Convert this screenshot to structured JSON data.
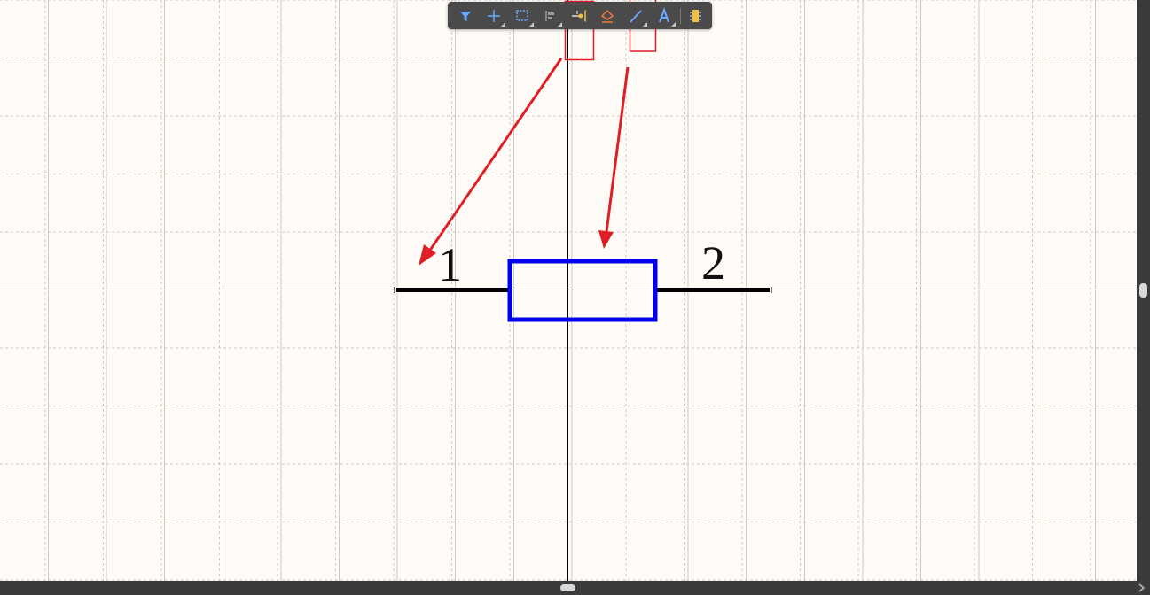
{
  "toolbar": {
    "buttons": [
      {
        "name": "filter",
        "icon": "filter-icon",
        "color": "#6aa9ff",
        "has_dropdown": false
      },
      {
        "name": "move",
        "icon": "crosshair-icon",
        "color": "#6aa9ff",
        "has_dropdown": true
      },
      {
        "name": "select",
        "icon": "selection-rectangle-icon",
        "color": "#6aa9ff",
        "has_dropdown": true
      },
      {
        "name": "align",
        "icon": "align-left-icon",
        "color": "#9a9a9a",
        "has_dropdown": true
      },
      {
        "name": "place-pin",
        "icon": "pin-icon",
        "color": "#f0c040",
        "has_dropdown": false
      },
      {
        "name": "place-polygon",
        "icon": "fill-shape-icon",
        "color": "#f07a40",
        "has_dropdown": false
      },
      {
        "name": "place-line",
        "icon": "line-icon",
        "color": "#6aa9ff",
        "has_dropdown": true
      },
      {
        "name": "place-text",
        "icon": "text-a-icon",
        "color": "#6aa9ff",
        "has_dropdown": true
      },
      {
        "name": "component",
        "icon": "component-icon",
        "color": "#f0c040",
        "has_dropdown": false
      }
    ]
  },
  "schematic": {
    "pin_labels": [
      "1",
      "2"
    ],
    "body_color": "#0000ee",
    "pin_color": "#000000"
  },
  "annotations": {
    "highlight_color": "#e01e26",
    "highlighted_buttons": [
      "place-pin",
      "place-line"
    ]
  },
  "colors": {
    "canvas": "#fffcf7",
    "grid": "#cdcac4",
    "toolbar": "#4a4a4a",
    "scrollbar": "#3b3b3b"
  }
}
